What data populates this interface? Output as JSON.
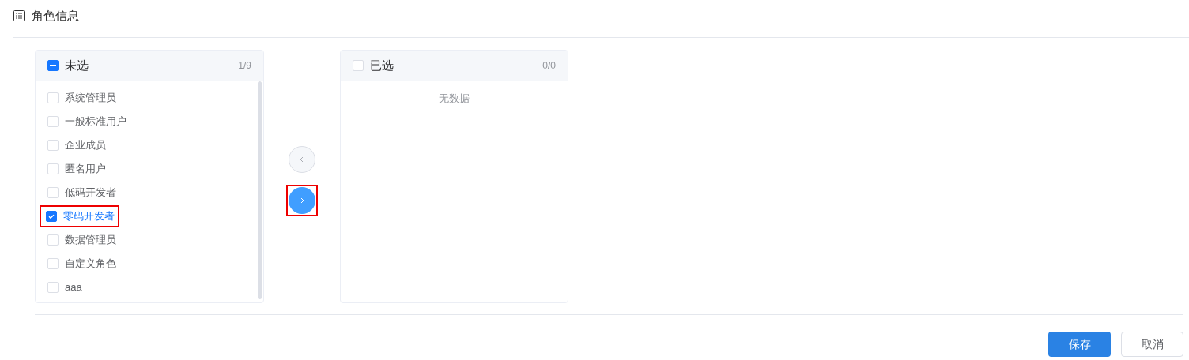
{
  "section": {
    "title": "角色信息"
  },
  "source_panel": {
    "title": "未选",
    "count": "1/9",
    "header_checked": false,
    "header_indeterminate": true,
    "items": [
      {
        "label": "系统管理员",
        "checked": false,
        "highlighted": false
      },
      {
        "label": "一般标准用户",
        "checked": false,
        "highlighted": false
      },
      {
        "label": "企业成员",
        "checked": false,
        "highlighted": false
      },
      {
        "label": "匿名用户",
        "checked": false,
        "highlighted": false
      },
      {
        "label": "低码开发者",
        "checked": false,
        "highlighted": false
      },
      {
        "label": "零码开发者",
        "checked": true,
        "highlighted": true
      },
      {
        "label": "数据管理员",
        "checked": false,
        "highlighted": false
      },
      {
        "label": "自定义角色",
        "checked": false,
        "highlighted": false
      },
      {
        "label": "aaa",
        "checked": false,
        "highlighted": false
      }
    ]
  },
  "transfer_buttons": [
    {
      "kind": "left",
      "disabled": true,
      "highlighted": false
    },
    {
      "kind": "right",
      "disabled": false,
      "highlighted": true
    }
  ],
  "target_panel": {
    "title": "已选",
    "count": "0/0",
    "header_checked": false,
    "header_indeterminate": false,
    "empty_text": "无数据"
  },
  "actions": [
    {
      "label": "保存",
      "kind": "primary"
    },
    {
      "label": "取消",
      "kind": "default"
    }
  ]
}
